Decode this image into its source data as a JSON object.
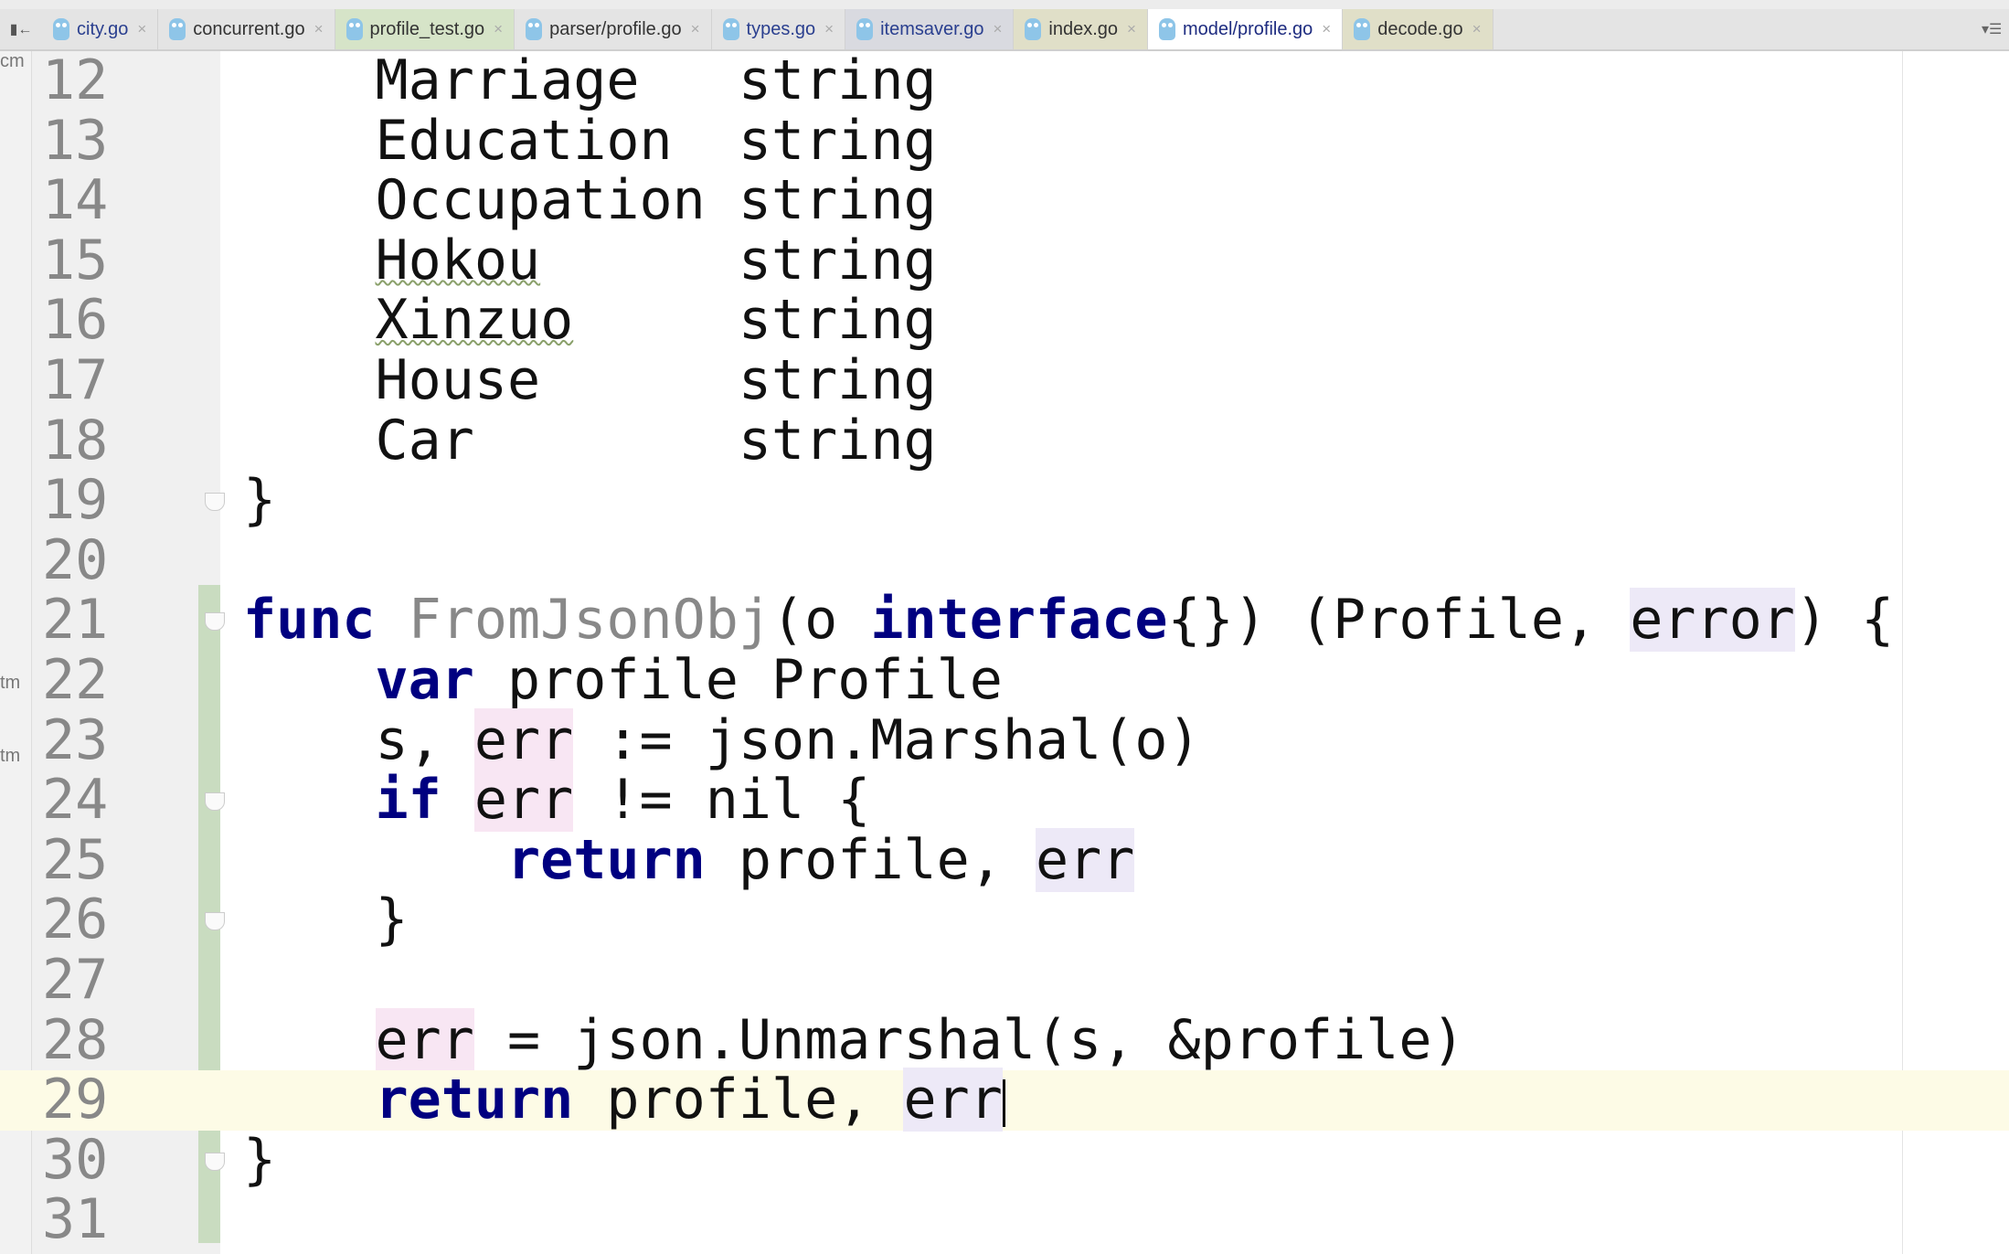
{
  "tabs": [
    {
      "label": "city.go",
      "style": "blue"
    },
    {
      "label": "concurrent.go",
      "style": ""
    },
    {
      "label": "profile_test.go",
      "style": "green"
    },
    {
      "label": "parser/profile.go",
      "style": ""
    },
    {
      "label": "types.go",
      "style": "blue"
    },
    {
      "label": "itemsaver.go",
      "style": "grayb blue"
    },
    {
      "label": "index.go",
      "style": "olive"
    },
    {
      "label": "model/profile.go",
      "style": "active"
    },
    {
      "label": "decode.go",
      "style": "olive"
    }
  ],
  "strip": [
    "cm",
    "tm",
    "tm"
  ],
  "current_line": 29,
  "lines": [
    {
      "n": "12",
      "t": [
        [
          "    Marriage   string",
          ""
        ]
      ]
    },
    {
      "n": "13",
      "t": [
        [
          "    Education  string",
          ""
        ]
      ]
    },
    {
      "n": "14",
      "t": [
        [
          "    Occupation string",
          ""
        ]
      ]
    },
    {
      "n": "15",
      "t": [
        [
          "    ",
          ""
        ],
        [
          "Hokou",
          "wavy"
        ],
        [
          "      string",
          ""
        ]
      ]
    },
    {
      "n": "16",
      "t": [
        [
          "    ",
          ""
        ],
        [
          "Xinzuo",
          "wavy"
        ],
        [
          "     string",
          ""
        ]
      ]
    },
    {
      "n": "17",
      "t": [
        [
          "    House      string",
          ""
        ]
      ]
    },
    {
      "n": "18",
      "t": [
        [
          "    Car        string",
          ""
        ]
      ]
    },
    {
      "n": "19",
      "t": [
        [
          "}",
          ""
        ]
      ],
      "fold": true
    },
    {
      "n": "20",
      "t": []
    },
    {
      "n": "21",
      "t": [
        [
          "func",
          "kw"
        ],
        [
          " ",
          ""
        ],
        [
          "FromJsonObj",
          "unused"
        ],
        [
          "(o ",
          ""
        ],
        [
          "interface",
          "kw"
        ],
        [
          "{}) (Profile, ",
          ""
        ],
        [
          "error",
          "hl"
        ],
        [
          ") {",
          ""
        ]
      ],
      "fold": true
    },
    {
      "n": "22",
      "t": [
        [
          "    ",
          ""
        ],
        [
          "var",
          "kw"
        ],
        [
          " profile Profile",
          ""
        ]
      ]
    },
    {
      "n": "23",
      "t": [
        [
          "    s, ",
          ""
        ],
        [
          "err",
          "hl2"
        ],
        [
          " := json.Marshal(o)",
          ""
        ]
      ]
    },
    {
      "n": "24",
      "t": [
        [
          "    ",
          ""
        ],
        [
          "if",
          "kw"
        ],
        [
          " ",
          ""
        ],
        [
          "err",
          "hl2"
        ],
        [
          " != nil {",
          ""
        ]
      ],
      "fold": true
    },
    {
      "n": "25",
      "t": [
        [
          "        ",
          ""
        ],
        [
          "return",
          "kw"
        ],
        [
          " profile, ",
          ""
        ],
        [
          "err",
          "hl"
        ]
      ]
    },
    {
      "n": "26",
      "t": [
        [
          "    }",
          ""
        ]
      ],
      "fold": true
    },
    {
      "n": "27",
      "t": []
    },
    {
      "n": "28",
      "t": [
        [
          "    ",
          ""
        ],
        [
          "err",
          "hl2"
        ],
        [
          " = json.Unmarshal(s, &profile)",
          ""
        ]
      ]
    },
    {
      "n": "29",
      "t": [
        [
          "    ",
          ""
        ],
        [
          "return",
          "kw"
        ],
        [
          " profile, ",
          ""
        ],
        [
          "err",
          "hl"
        ]
      ],
      "caret": true
    },
    {
      "n": "30",
      "t": [
        [
          "}",
          ""
        ]
      ],
      "fold": true
    },
    {
      "n": "31",
      "t": []
    }
  ]
}
